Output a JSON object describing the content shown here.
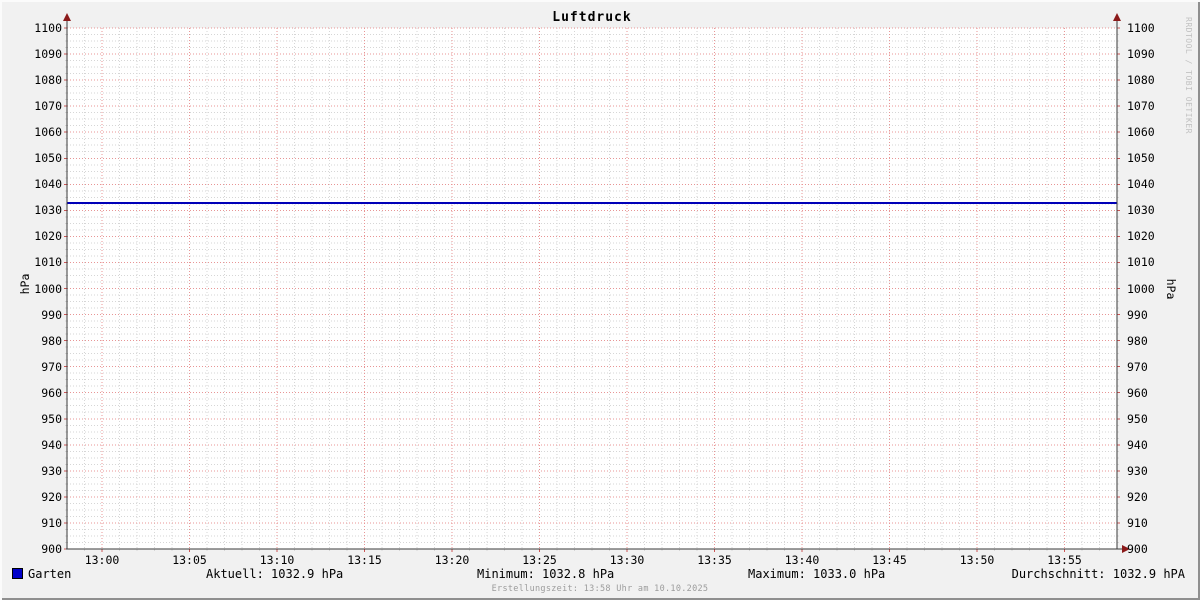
{
  "title": "Luftdruck",
  "watermark": "RRDTOOL / TOBI OETIKER",
  "footer": "Erstellungszeit: 13:58 Uhr am 10.10.2025",
  "axes": {
    "unit_left": "hPa",
    "unit_right": "hPa"
  },
  "legend": {
    "series_label": "Garten",
    "series_color": "#0000c8",
    "aktuell": "Aktuell: 1032.9 hPa",
    "minimum": "Minimum: 1032.8 hPa",
    "maximum": "Maximum: 1033.0 hPa",
    "durchschnitt": "Durchschnitt: 1032.9 hPA"
  },
  "colors": {
    "background": "#f1f1f1",
    "plot_background": "#ffffff",
    "grid_minor": "#d6d6d6",
    "grid_major": "#e89595",
    "tick_stub_major": "#cc5555",
    "axis": "#3a3a3a",
    "arrow": "#8b1a1a",
    "series_line": "#0000b8"
  },
  "chart_data": {
    "type": "line",
    "title": "Luftdruck",
    "ylabel": "hPa",
    "ylim": [
      900,
      1100
    ],
    "y_tick_step": 10,
    "y_minor_step": 2.5,
    "y_ticks": [
      "1100",
      "1090",
      "1080",
      "1070",
      "1060",
      "1050",
      "1040",
      "1030",
      "1020",
      "1010",
      "1000",
      "990",
      "980",
      "970",
      "960",
      "950",
      "940",
      "930",
      "920",
      "910",
      "900"
    ],
    "x_ticks": [
      "13:00",
      "13:05",
      "13:10",
      "13:15",
      "13:20",
      "13:25",
      "13:30",
      "13:35",
      "13:40",
      "13:45",
      "13:50",
      "13:55"
    ],
    "time_start": "12:58",
    "time_end": "13:58",
    "x_minor_step_min": 1,
    "x_major_step_min": 5,
    "grid": true,
    "legend_position": "bottom",
    "series": [
      {
        "name": "Garten",
        "color": "#0000c8",
        "constant_value_hpa": 1032.9
      }
    ],
    "stats": {
      "aktuell_hpa": 1032.9,
      "minimum_hpa": 1032.8,
      "maximum_hpa": 1033.0,
      "durchschnitt_hpa": 1032.9
    }
  }
}
